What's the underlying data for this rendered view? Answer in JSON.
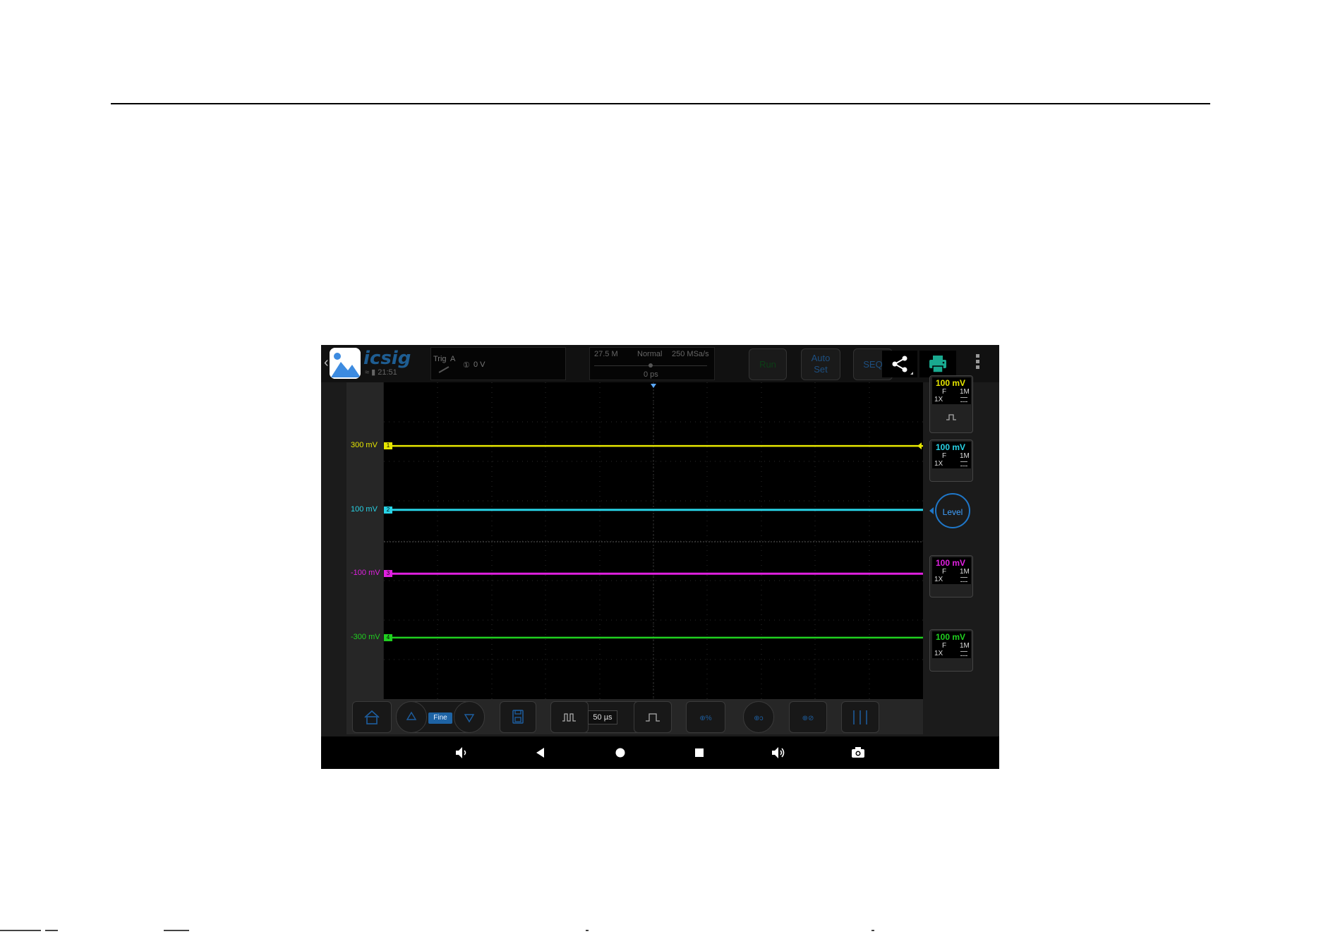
{
  "app": {
    "logo_text": "icsig",
    "status_time": "21:51"
  },
  "trigger": {
    "label": "Trig",
    "source": "A",
    "level": "0 V"
  },
  "acquisition": {
    "memory_depth": "27.5 M",
    "mode": "Normal",
    "sample_rate": "250 MSa/s",
    "horizontal_position": "0 ps"
  },
  "top_buttons": {
    "run": "Run",
    "auto_line1": "Auto",
    "auto_line2": "Set",
    "seq": "SEQ"
  },
  "channels": [
    {
      "offset_label": "300 mV",
      "marker": "1",
      "color": "#e6e600",
      "scale": "100 mV",
      "coupling": "F",
      "impedance": "1M",
      "probe": "1X"
    },
    {
      "offset_label": "100 mV",
      "marker": "2",
      "color": "#28d3e6",
      "scale": "100 mV",
      "coupling": "F",
      "impedance": "1M",
      "probe": "1X"
    },
    {
      "offset_label": "-100 mV",
      "marker": "3",
      "color": "#e020e0",
      "scale": "100 mV",
      "coupling": "F",
      "impedance": "1M",
      "probe": "1X"
    },
    {
      "offset_label": "-300 mV",
      "marker": "4",
      "color": "#20d020",
      "scale": "100 mV",
      "coupling": "F",
      "impedance": "1M",
      "probe": "1X"
    }
  ],
  "right_panel": {
    "level_label": "Level"
  },
  "bottom_toolbar": {
    "fine_label": "Fine",
    "timebase": "50 µs"
  },
  "colors": {
    "accent": "#1f77c9",
    "background": "#000000"
  }
}
